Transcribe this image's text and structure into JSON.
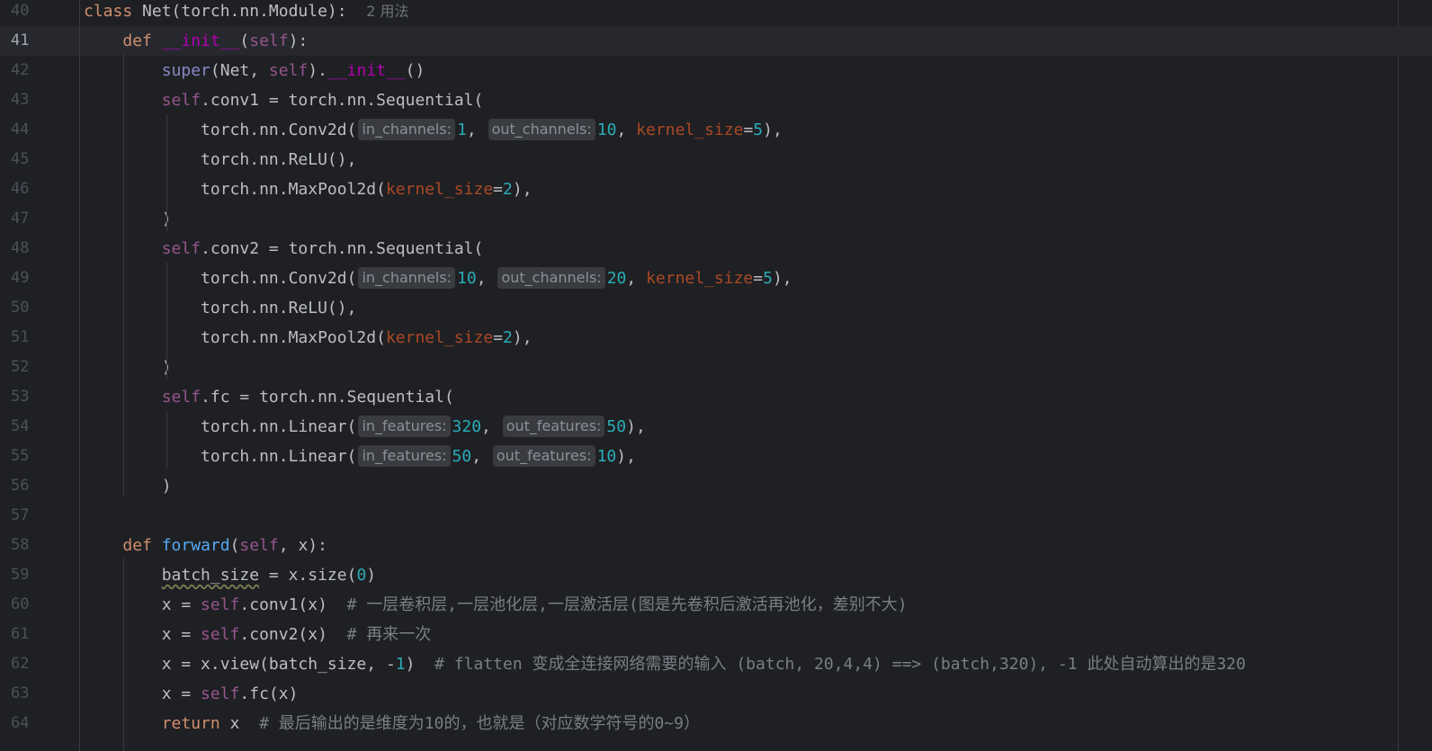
{
  "lines": [
    {
      "n": "40",
      "tokens": [
        {
          "t": "kw",
          "v": "class"
        },
        {
          "t": "p",
          "v": " Net(torch.nn.Module):  "
        },
        {
          "t": "usage",
          "v": "2 用法"
        }
      ]
    },
    {
      "n": "41",
      "current": true,
      "tokens": [
        {
          "t": "p",
          "v": "    "
        },
        {
          "t": "kw",
          "v": "def"
        },
        {
          "t": "p",
          "v": " "
        },
        {
          "t": "dunder",
          "v": "__init__"
        },
        {
          "t": "p",
          "v": "("
        },
        {
          "t": "self",
          "v": "self"
        },
        {
          "t": "p",
          "v": "):"
        }
      ]
    },
    {
      "n": "42",
      "tokens": [
        {
          "t": "p",
          "v": "        "
        },
        {
          "t": "builtin",
          "v": "super"
        },
        {
          "t": "p",
          "v": "(Net, "
        },
        {
          "t": "self",
          "v": "self"
        },
        {
          "t": "p",
          "v": ")."
        },
        {
          "t": "dunder",
          "v": "__init__"
        },
        {
          "t": "p",
          "v": "()"
        }
      ]
    },
    {
      "n": "43",
      "tokens": [
        {
          "t": "p",
          "v": "        "
        },
        {
          "t": "self",
          "v": "self"
        },
        {
          "t": "p",
          "v": ".conv1 = torch.nn.Sequential("
        }
      ]
    },
    {
      "n": "44",
      "tokens": [
        {
          "t": "p",
          "v": "            torch.nn.Conv2d("
        },
        {
          "t": "hint",
          "v": "in_channels:"
        },
        {
          "t": "num",
          "v": "1"
        },
        {
          "t": "p",
          "v": ", "
        },
        {
          "t": "hint",
          "v": "out_channels:"
        },
        {
          "t": "num",
          "v": "10"
        },
        {
          "t": "p",
          "v": ", "
        },
        {
          "t": "kwarg",
          "v": "kernel_size"
        },
        {
          "t": "p",
          "v": "="
        },
        {
          "t": "num",
          "v": "5"
        },
        {
          "t": "p",
          "v": "),"
        }
      ]
    },
    {
      "n": "45",
      "tokens": [
        {
          "t": "p",
          "v": "            torch.nn.ReLU(),"
        }
      ]
    },
    {
      "n": "46",
      "tokens": [
        {
          "t": "p",
          "v": "            torch.nn.MaxPool2d("
        },
        {
          "t": "kwarg",
          "v": "kernel_size"
        },
        {
          "t": "p",
          "v": "="
        },
        {
          "t": "num",
          "v": "2"
        },
        {
          "t": "p",
          "v": "),"
        }
      ]
    },
    {
      "n": "47",
      "tokens": [
        {
          "t": "p",
          "v": "        )"
        }
      ]
    },
    {
      "n": "48",
      "tokens": [
        {
          "t": "p",
          "v": "        "
        },
        {
          "t": "self",
          "v": "self"
        },
        {
          "t": "p",
          "v": ".conv2 = torch.nn.Sequential("
        }
      ]
    },
    {
      "n": "49",
      "tokens": [
        {
          "t": "p",
          "v": "            torch.nn.Conv2d("
        },
        {
          "t": "hint",
          "v": "in_channels:"
        },
        {
          "t": "num",
          "v": "10"
        },
        {
          "t": "p",
          "v": ", "
        },
        {
          "t": "hint",
          "v": "out_channels:"
        },
        {
          "t": "num",
          "v": "20"
        },
        {
          "t": "p",
          "v": ", "
        },
        {
          "t": "kwarg",
          "v": "kernel_size"
        },
        {
          "t": "p",
          "v": "="
        },
        {
          "t": "num",
          "v": "5"
        },
        {
          "t": "p",
          "v": "),"
        }
      ]
    },
    {
      "n": "50",
      "tokens": [
        {
          "t": "p",
          "v": "            torch.nn.ReLU(),"
        }
      ]
    },
    {
      "n": "51",
      "tokens": [
        {
          "t": "p",
          "v": "            torch.nn.MaxPool2d("
        },
        {
          "t": "kwarg",
          "v": "kernel_size"
        },
        {
          "t": "p",
          "v": "="
        },
        {
          "t": "num",
          "v": "2"
        },
        {
          "t": "p",
          "v": "),"
        }
      ]
    },
    {
      "n": "52",
      "tokens": [
        {
          "t": "p",
          "v": "        )"
        }
      ]
    },
    {
      "n": "53",
      "tokens": [
        {
          "t": "p",
          "v": "        "
        },
        {
          "t": "self",
          "v": "self"
        },
        {
          "t": "p",
          "v": ".fc = torch.nn.Sequential("
        }
      ]
    },
    {
      "n": "54",
      "tokens": [
        {
          "t": "p",
          "v": "            torch.nn.Linear("
        },
        {
          "t": "hint",
          "v": "in_features:"
        },
        {
          "t": "num",
          "v": "320"
        },
        {
          "t": "p",
          "v": ", "
        },
        {
          "t": "hint",
          "v": "out_features:"
        },
        {
          "t": "num",
          "v": "50"
        },
        {
          "t": "p",
          "v": "),"
        }
      ]
    },
    {
      "n": "55",
      "tokens": [
        {
          "t": "p",
          "v": "            torch.nn.Linear("
        },
        {
          "t": "hint",
          "v": "in_features:"
        },
        {
          "t": "num",
          "v": "50"
        },
        {
          "t": "p",
          "v": ", "
        },
        {
          "t": "hint",
          "v": "out_features:"
        },
        {
          "t": "num",
          "v": "10"
        },
        {
          "t": "p",
          "v": "),"
        }
      ]
    },
    {
      "n": "56",
      "tokens": [
        {
          "t": "p",
          "v": "        )"
        }
      ]
    },
    {
      "n": "57",
      "tokens": []
    },
    {
      "n": "58",
      "tokens": [
        {
          "t": "p",
          "v": "    "
        },
        {
          "t": "kw",
          "v": "def"
        },
        {
          "t": "p",
          "v": " "
        },
        {
          "t": "fn",
          "v": "forward"
        },
        {
          "t": "p",
          "v": "("
        },
        {
          "t": "self",
          "v": "self"
        },
        {
          "t": "p",
          "v": ", x):"
        }
      ]
    },
    {
      "n": "59",
      "tokens": [
        {
          "t": "p",
          "v": "        "
        },
        {
          "t": "squiggle",
          "v": "batch_size"
        },
        {
          "t": "p",
          "v": " = x.size("
        },
        {
          "t": "num",
          "v": "0"
        },
        {
          "t": "p",
          "v": ")"
        }
      ]
    },
    {
      "n": "60",
      "tokens": [
        {
          "t": "p",
          "v": "        x = "
        },
        {
          "t": "self",
          "v": "self"
        },
        {
          "t": "p",
          "v": ".conv1(x)  "
        },
        {
          "t": "cmt",
          "v": "# 一层卷积层,一层池化层,一层激活层(图是先卷积后激活再池化，差别不大)"
        }
      ]
    },
    {
      "n": "61",
      "tokens": [
        {
          "t": "p",
          "v": "        x = "
        },
        {
          "t": "self",
          "v": "self"
        },
        {
          "t": "p",
          "v": ".conv2(x)  "
        },
        {
          "t": "cmt",
          "v": "# 再来一次"
        }
      ]
    },
    {
      "n": "62",
      "tokens": [
        {
          "t": "p",
          "v": "        x = x.view(batch_size, -"
        },
        {
          "t": "num",
          "v": "1"
        },
        {
          "t": "p",
          "v": ")  "
        },
        {
          "t": "cmt",
          "v": "# flatten 变成全连接网络需要的输入 (batch, 20,4,4) ==> (batch,320), -1 此处自动算出的是320"
        }
      ]
    },
    {
      "n": "63",
      "tokens": [
        {
          "t": "p",
          "v": "        x = "
        },
        {
          "t": "self",
          "v": "self"
        },
        {
          "t": "p",
          "v": ".fc(x)"
        }
      ]
    },
    {
      "n": "64",
      "tokens": [
        {
          "t": "p",
          "v": "        "
        },
        {
          "t": "kw",
          "v": "return"
        },
        {
          "t": "p",
          "v": " x  "
        },
        {
          "t": "cmt",
          "v": "# 最后输出的是维度为10的，也就是（对应数学符号的0~9）"
        }
      ]
    }
  ]
}
